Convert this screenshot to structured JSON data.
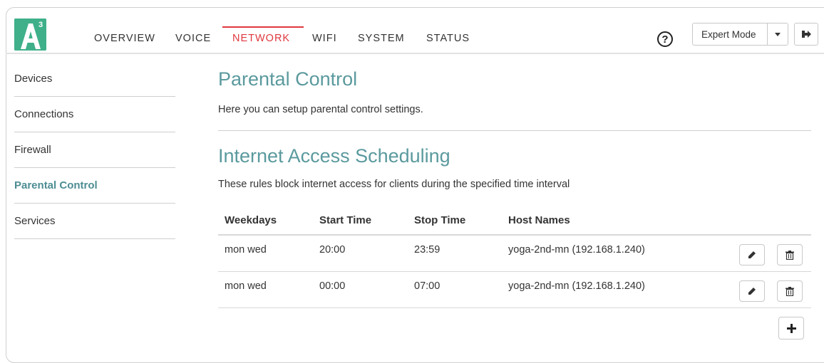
{
  "brand": {
    "logo_letter": "A",
    "logo_superscript": "3",
    "color": "#3fb08a"
  },
  "nav": {
    "items": [
      {
        "label": "OVERVIEW",
        "active": false
      },
      {
        "label": "VOICE",
        "active": false
      },
      {
        "label": "NETWORK",
        "active": true
      },
      {
        "label": "WIFI",
        "active": false
      },
      {
        "label": "SYSTEM",
        "active": false
      },
      {
        "label": "STATUS",
        "active": false
      }
    ],
    "active_color": "#e0383f"
  },
  "header": {
    "help_icon": "question-circle-icon",
    "help_symbol": "?",
    "mode_select_value": "Expert Mode",
    "logout_icon": "sign-out-icon"
  },
  "sidebar": {
    "items": [
      {
        "label": "Devices",
        "active": false
      },
      {
        "label": "Connections",
        "active": false
      },
      {
        "label": "Firewall",
        "active": false
      },
      {
        "label": "Parental Control",
        "active": true
      },
      {
        "label": "Services",
        "active": false
      }
    ],
    "active_color": "#4d8d93"
  },
  "main": {
    "title": "Parental Control",
    "description": "Here you can setup parental control settings.",
    "section_title": "Internet Access Scheduling",
    "section_description": "These rules block internet access for clients during the specified time interval",
    "heading_color": "#5b9a9e",
    "table": {
      "headers": [
        "Weekdays",
        "Start Time",
        "Stop Time",
        "Host Names"
      ],
      "rows": [
        {
          "weekdays": "mon wed",
          "start": "20:00",
          "stop": "23:59",
          "host": "yoga-2nd-mn (192.168.1.240)"
        },
        {
          "weekdays": "mon wed",
          "start": "00:00",
          "stop": "07:00",
          "host": "yoga-2nd-mn (192.168.1.240)"
        }
      ],
      "row_actions": [
        "pencil-icon",
        "trash-icon"
      ],
      "add_icon": "plus-icon"
    }
  }
}
